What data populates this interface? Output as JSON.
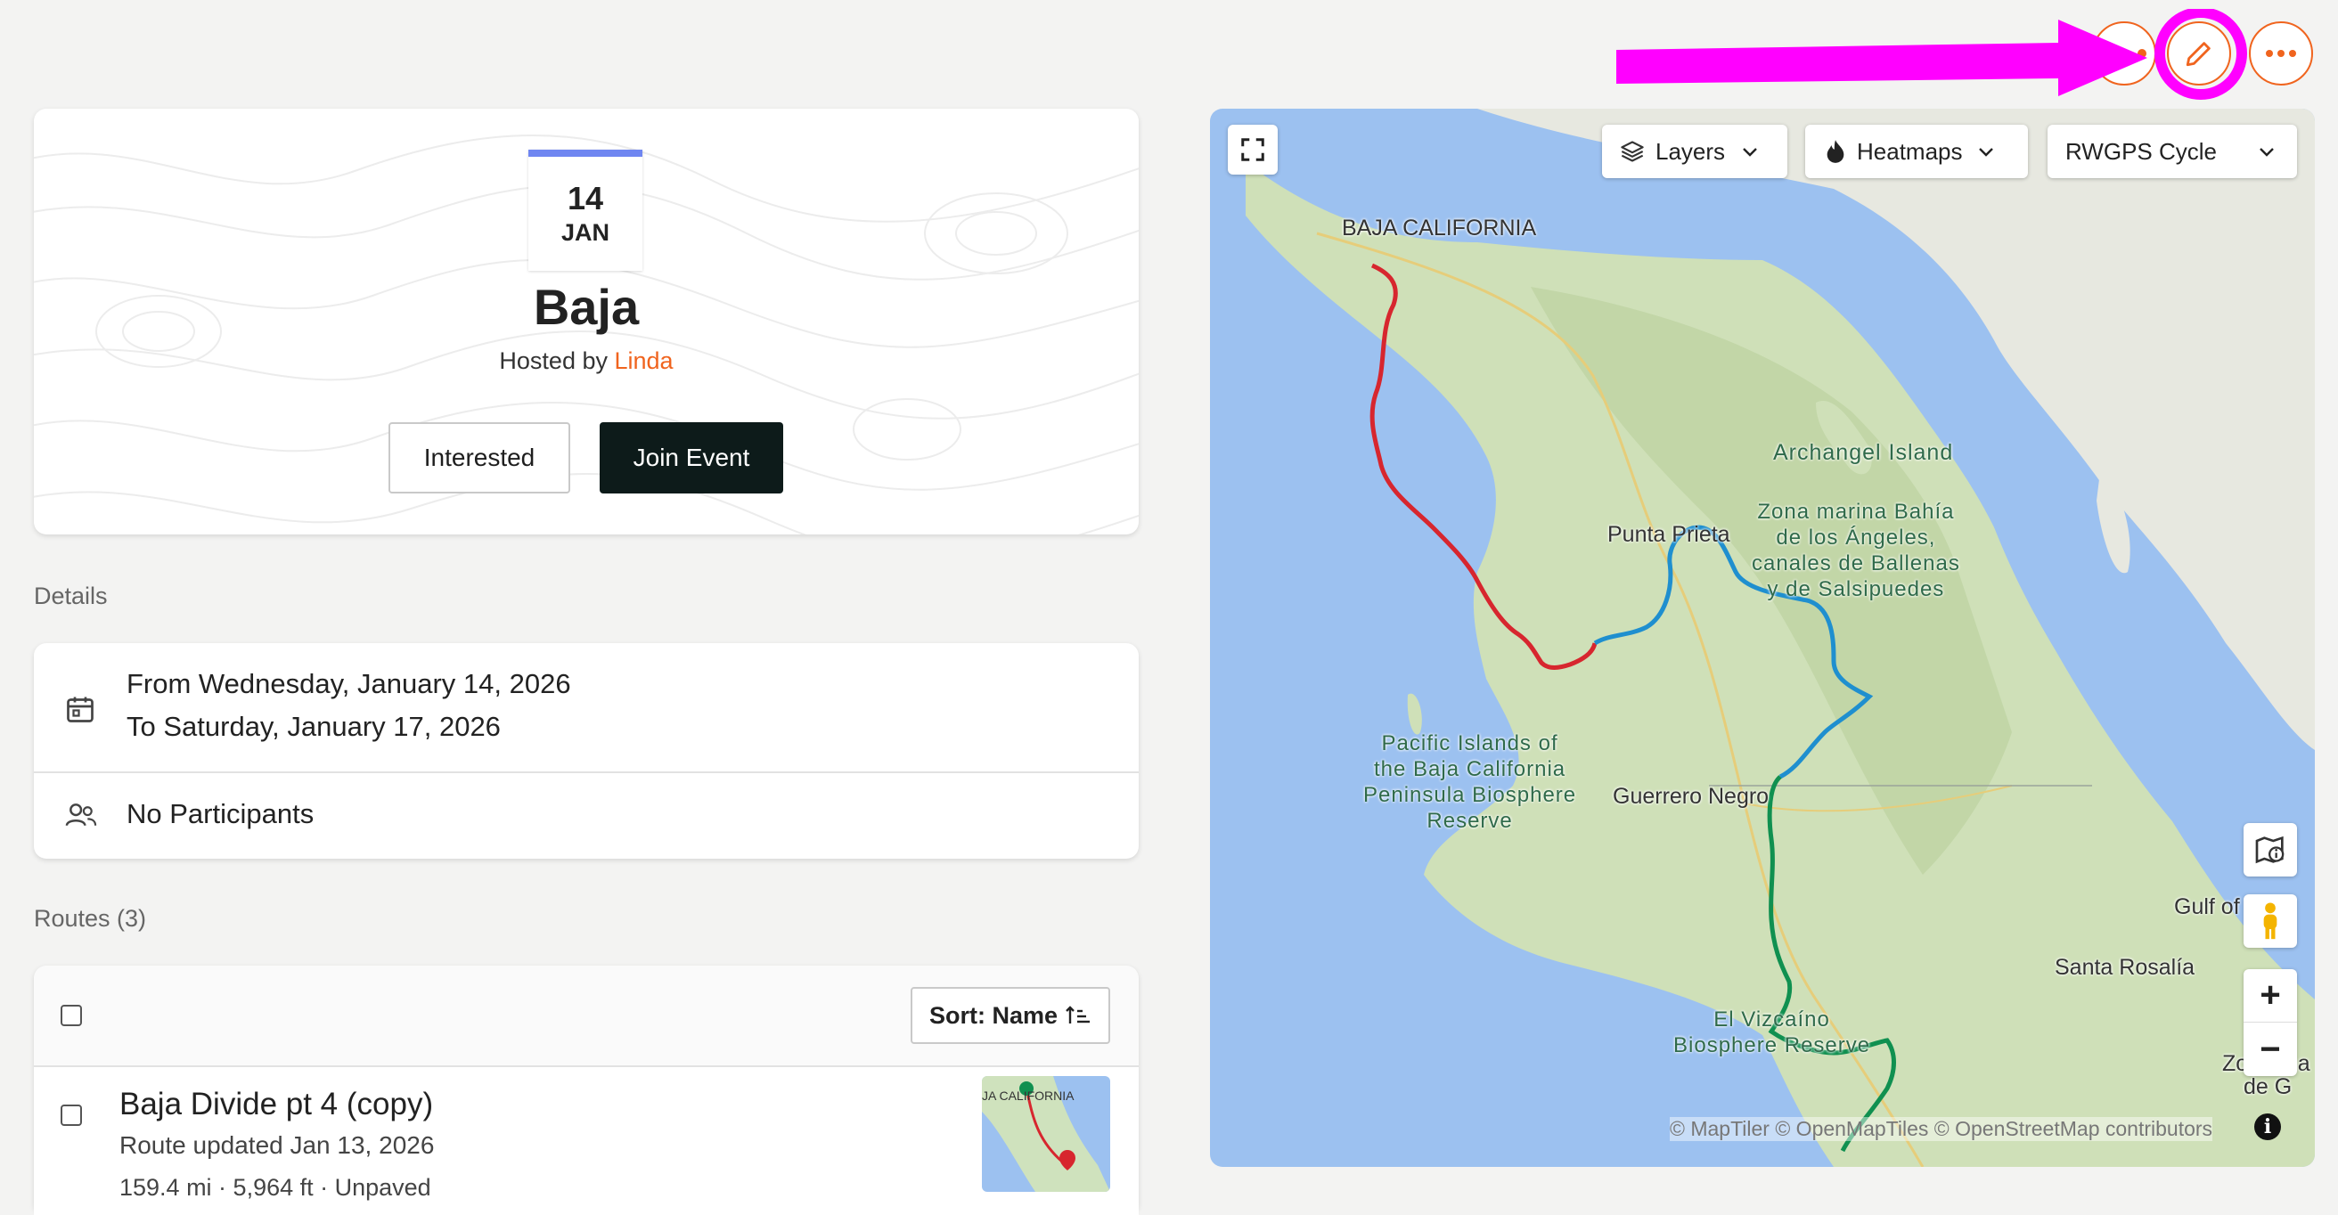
{
  "event": {
    "date_day": "14",
    "date_month": "JAN",
    "title": "Baja",
    "hosted_by_prefix": "Hosted by",
    "host_name": "Linda",
    "interested_label": "Interested",
    "join_label": "Join Event"
  },
  "details": {
    "section_label": "Details",
    "date_from": "From Wednesday, January 14, 2026",
    "date_to": "To Saturday, January 17, 2026",
    "participants": "No Participants"
  },
  "routes": {
    "section_label": "Routes (3)",
    "sort_label": "Sort: Name",
    "items": [
      {
        "name": "Baja Divide pt 4 (copy)",
        "updated": "Route updated Jan 13, 2026",
        "stats": "159.4 mi · 5,964 ft · Unpaved",
        "thumb_label": "JA CALIFORNIA"
      }
    ]
  },
  "map": {
    "layers_label": "Layers",
    "heatmaps_label": "Heatmaps",
    "style_label": "RWGPS Cycle",
    "attribution": "© MapTiler © OpenMapTiles © OpenStreetMap contributors",
    "labels": {
      "baja_california": "BAJA CALIFORNIA",
      "archangel": "Archangel Island",
      "zona_marina": "Zona marina Bahía\nde los Ángeles,\ncanales de Ballenas\ny de Salsipuedes",
      "punta_prieta": "Punta Prieta",
      "pacific_islands": "Pacific Islands of\nthe Baja California\nPeninsula Biosphere\nReserve",
      "guerrero_negro": "Guerrero Negro",
      "gulf_of": "Gulf of",
      "santa_rosalia": "Santa Rosalía",
      "el_vizcaino": "El Vizcaíno\nBiosphere Reserve",
      "zona_cut": "Zona ma",
      "de_g": "de G"
    },
    "zoom_in": "+",
    "zoom_out": "−",
    "route_colors": [
      "#d7262e",
      "#1f8fcf",
      "#109050"
    ]
  },
  "colors": {
    "accent": "#f0641e",
    "annotation": "#ff00ff",
    "date_bar": "#6f86f1",
    "join_bg": "#0d1b1a"
  },
  "icons": {
    "calendar": "calendar-icon",
    "people": "people-icon",
    "edit": "pencil-icon",
    "more": "more-horizontal-icon",
    "fullscreen": "fullscreen-icon",
    "layers": "layers-icon",
    "heatmap": "flame-icon",
    "chevron": "chevron-down-icon",
    "pegman": "pegman-icon",
    "map_info": "map-info-icon",
    "info": "info-icon",
    "sort": "sort-ascending-icon"
  }
}
